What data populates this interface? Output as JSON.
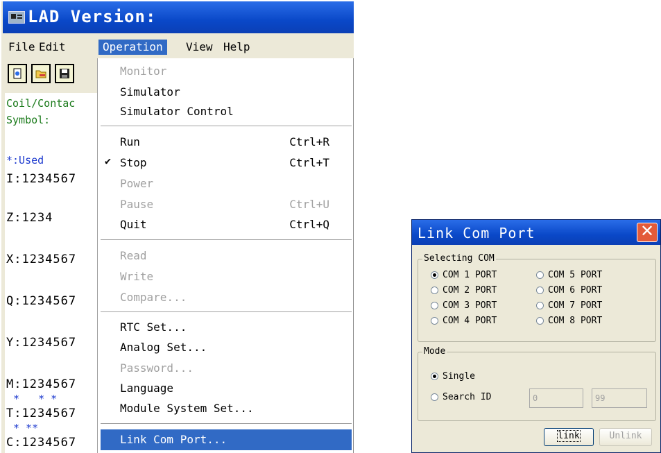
{
  "lad_window": {
    "title": "LAD Version:",
    "menubar": [
      "File",
      "Edit",
      "Operation",
      "View",
      "Help"
    ],
    "toolbar": [
      {
        "icon": "new-document-icon"
      },
      {
        "icon": "open-folder-icon"
      },
      {
        "icon": "save-disk-icon"
      }
    ],
    "side_panel": {
      "label1": "Coil/Contac",
      "label2": "Symbol:",
      "used": "*:Used",
      "rows": [
        "I:1234567",
        "Z:1234",
        "X:1234567",
        "Q:1234567",
        "Y:1234567",
        "M:1234567",
        "*   * *",
        "T:1234567",
        "* **",
        "C:1234567"
      ]
    }
  },
  "operation_menu": {
    "items": [
      {
        "label": "Monitor",
        "disabled": true
      },
      {
        "label": "Simulator",
        "disabled": false
      },
      {
        "label": "Simulator Control",
        "disabled": false
      },
      {
        "label": "Run",
        "shortcut": "Ctrl+R",
        "disabled": false
      },
      {
        "label": "Stop",
        "shortcut": "Ctrl+T",
        "disabled": false,
        "checked": true
      },
      {
        "label": "Power",
        "disabled": true
      },
      {
        "label": "Pause",
        "shortcut": "Ctrl+U",
        "disabled": true
      },
      {
        "label": "Quit",
        "shortcut": "Ctrl+Q",
        "disabled": false
      },
      {
        "label": "Read",
        "disabled": true
      },
      {
        "label": "Write",
        "disabled": true
      },
      {
        "label": "Compare...",
        "disabled": true
      },
      {
        "label": "RTC Set...",
        "disabled": false
      },
      {
        "label": "Analog Set...",
        "disabled": false
      },
      {
        "label": "Password...",
        "disabled": true
      },
      {
        "label": "Language",
        "disabled": false
      },
      {
        "label": "Module System Set...",
        "disabled": false
      },
      {
        "label": "Link Com Port...",
        "disabled": false,
        "highlighted": true
      }
    ],
    "check_mark": "✔"
  },
  "link_dialog": {
    "title": "Link Com Port",
    "close_glyph": "✕",
    "selecting_com": {
      "legend": "Selecting COM",
      "ports": [
        "COM 1 PORT",
        "COM 2 PORT",
        "COM 3 PORT",
        "COM 4 PORT",
        "COM 5 PORT",
        "COM 6 PORT",
        "COM 7 PORT",
        "COM 8 PORT"
      ],
      "selected": "COM 1 PORT"
    },
    "mode": {
      "legend": "Mode",
      "single": "Single",
      "search_id": "Search ID",
      "selected": "Single",
      "id_from": "0",
      "id_to": "99"
    },
    "buttons": {
      "link": "link",
      "unlink": "Unlink"
    },
    "colors": {
      "titlebar": "#0a48c8",
      "close": "#e35b3a",
      "highlight": "#316ac5"
    }
  }
}
